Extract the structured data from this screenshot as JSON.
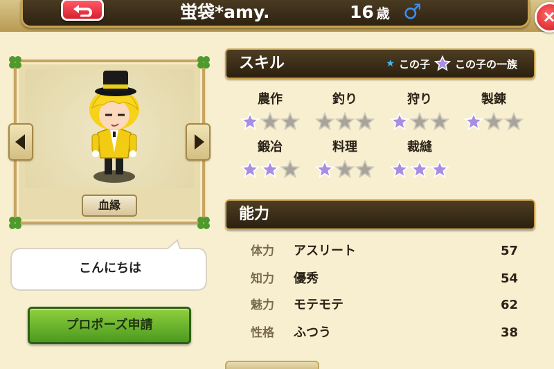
{
  "header": {
    "name": "蛍袋*amy.",
    "age_number": "16",
    "age_unit": "歳",
    "gender_symbol": "♂",
    "close_symbol": "×"
  },
  "portrait": {
    "lineage_label": "血縁"
  },
  "speech": {
    "text": "こんにちは"
  },
  "actions": {
    "propose_label": "プロポーズ申請"
  },
  "skills": {
    "title": "スキル",
    "legend_child": "この子",
    "legend_family": "この子の一族",
    "items": [
      {
        "label": "農作",
        "stars": [
          "family",
          "empty",
          "empty"
        ]
      },
      {
        "label": "釣り",
        "stars": [
          "empty",
          "empty",
          "empty"
        ]
      },
      {
        "label": "狩り",
        "stars": [
          "family",
          "empty",
          "empty"
        ]
      },
      {
        "label": "製錬",
        "stars": [
          "family",
          "empty",
          "empty"
        ]
      },
      {
        "label": "鍛冶",
        "stars": [
          "family",
          "family",
          "empty"
        ]
      },
      {
        "label": "料理",
        "stars": [
          "family",
          "empty",
          "empty"
        ]
      },
      {
        "label": "裁縫",
        "stars": [
          "family",
          "family",
          "family"
        ]
      }
    ]
  },
  "abilities": {
    "title": "能力",
    "rows": [
      {
        "label": "体力",
        "text": "アスリート",
        "value": "57"
      },
      {
        "label": "知力",
        "text": "優秀",
        "value": "54"
      },
      {
        "label": "魅力",
        "text": "モテモテ",
        "value": "62"
      },
      {
        "label": "性格",
        "text": "ふつう",
        "value": "38"
      }
    ]
  },
  "colors": {
    "star_family": "#a98de0",
    "star_empty": "#a9a49a",
    "star_child": "#48b9f5",
    "gender": "#3a8ff0",
    "propose_green": "#6db32e"
  }
}
